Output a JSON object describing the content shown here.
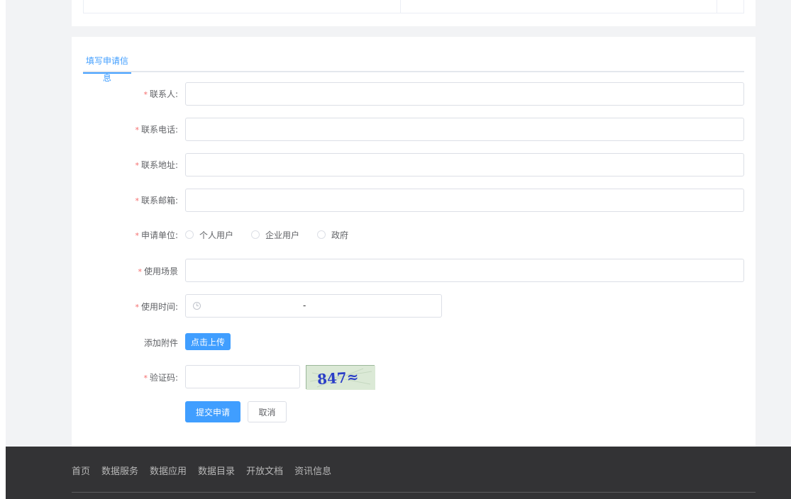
{
  "tab": {
    "label": "填写申请信息"
  },
  "form": {
    "contact_label": "联系人:",
    "phone_label": "联系电话:",
    "address_label": "联系地址:",
    "email_label": "联系邮箱:",
    "unit_label": "申请单位:",
    "unit_options": [
      "个人用户",
      "企业用户",
      "政府"
    ],
    "scene_label": "使用场景",
    "time_label": "使用时间:",
    "time_separator": "-",
    "attachment_label": "添加附件",
    "upload_button": "点击上传",
    "captcha_label": "验证码:",
    "captcha_text": "847≈",
    "submit_button": "提交申请",
    "cancel_button": "取消",
    "required_mark": "*"
  },
  "footer": {
    "nav": [
      "首页",
      "数据服务",
      "数据应用",
      "数据目录",
      "开放文档",
      "资讯信息"
    ]
  },
  "colors": {
    "primary": "#409eff",
    "required": "#f56c6c",
    "footer_bg": "#333335"
  }
}
